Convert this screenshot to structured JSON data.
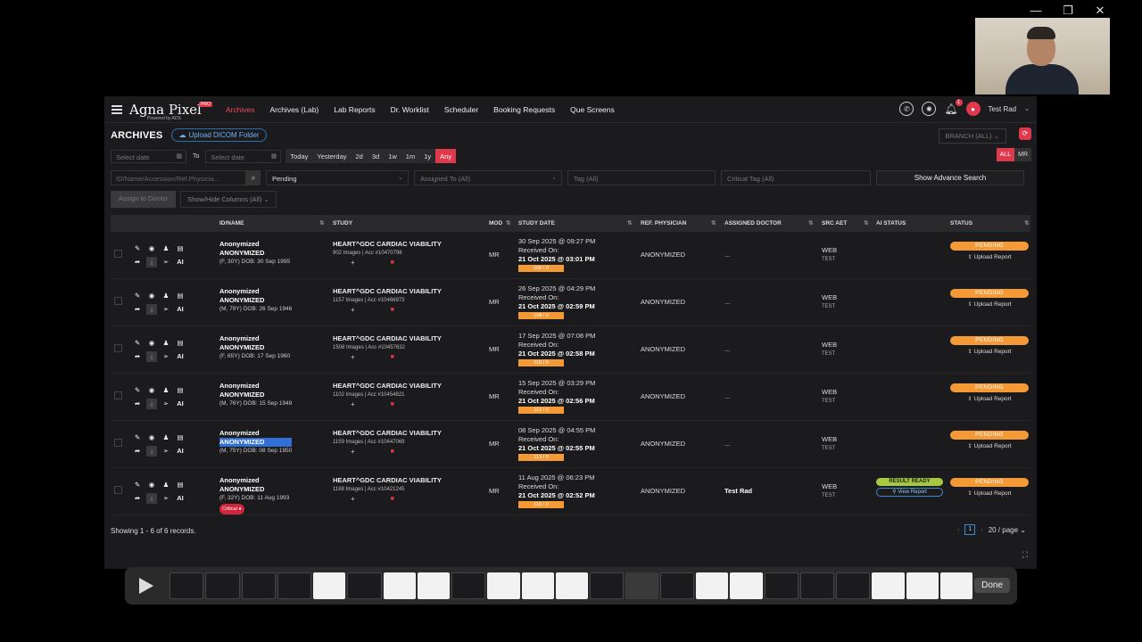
{
  "window": {
    "minimize": "—",
    "maximize": "❐",
    "close": "✕"
  },
  "brand": {
    "name_a": "Agna",
    "name_b": "Pixel",
    "badge": "PRO",
    "powered": "Powered by ADS"
  },
  "nav": [
    "Archives",
    "Archives (Lab)",
    "Lab Reports",
    "Dr. Worklist",
    "Scheduler",
    "Booking Requests",
    "Que Screens"
  ],
  "user": {
    "name": "Test Rad",
    "notifications": "1"
  },
  "header": {
    "title": "ARCHIVES",
    "upload": "Upload DICOM Folder",
    "branch": "BRANCH (ALL)"
  },
  "filters": {
    "date_from_ph": "Select date",
    "to_label": "To",
    "date_to_ph": "Select date",
    "quick": [
      "Today",
      "Yesterday",
      "2d",
      "3d",
      "1w",
      "1m",
      "1y",
      "Any"
    ],
    "modality": [
      "ALL",
      "MR"
    ],
    "search_ph": "ID/Name/Accession/Ref.Physicia...",
    "status_value": "Pending",
    "assigned_ph": "Assigned To (All)",
    "tag_ph": "Tag (All)",
    "critical_ph": "Critical Tag (All)",
    "advance": "Show Advance Search",
    "assign_btn": "Assign to Doctor",
    "cols_btn": "Show/Hide Columns (All)"
  },
  "columns": {
    "id": "ID/NAME",
    "study": "STUDY",
    "mod": "MOD",
    "date": "STUDY DATE",
    "ref": "REF. PHYSICIAN",
    "doc": "ASSIGNED DOCTOR",
    "aet": "SRC AET",
    "ai": "AI STATUS",
    "status": "STATUS"
  },
  "rows": [
    {
      "name": "Anonymized",
      "name2": "ANONYMIZED",
      "meta": "(F, 30Y) DOB: 30 Sep 1995",
      "study": "HEART^GDC CARDIAC VIABILITY",
      "images": "902 Images | Acc #10470798",
      "mod": "MR",
      "date": "30 Sep 2025 @ 09:27 PM",
      "recv_label": "Received On:",
      "recv": "21 Oct 2025 @ 03:01 PM",
      "count": "106 / 0",
      "ref": "ANONYMIZED",
      "doctor": "...",
      "aet1": "WEB",
      "aet2": "TEST",
      "status": "PENDING",
      "upload": "Upload Report"
    },
    {
      "name": "Anonymized",
      "name2": "ANONYMIZED",
      "meta": "(M, 79Y) DOB: 26 Sep 1946",
      "study": "HEART^GDC CARDIAC VIABILITY",
      "images": "1157 Images | Acc #10466973",
      "mod": "MR",
      "date": "26 Sep 2025 @ 04:29 PM",
      "recv_label": "Received On:",
      "recv": "21 Oct 2025 @ 02:59 PM",
      "count": "108 / 0",
      "ref": "ANONYMIZED",
      "doctor": "...",
      "aet1": "WEB",
      "aet2": "TEST",
      "status": "PENDING",
      "upload": "Upload Report"
    },
    {
      "name": "Anonymized",
      "name2": "ANONYMIZED",
      "meta": "(F, 65Y) DOB: 17 Sep 1960",
      "study": "HEART^GDC CARDIAC VIABILITY",
      "images": "1508 Images | Acc #10457632",
      "mod": "MR",
      "date": "17 Sep 2025 @ 07:08 PM",
      "recv_label": "Received On:",
      "recv": "21 Oct 2025 @ 02:58 PM",
      "count": "116 / 0",
      "ref": "ANONYMIZED",
      "doctor": "...",
      "aet1": "WEB",
      "aet2": "TEST",
      "status": "PENDING",
      "upload": "Upload Report"
    },
    {
      "name": "Anonymized",
      "name2": "ANONYMIZED",
      "meta": "(M, 76Y) DOB: 15 Sep 1949",
      "study": "HEART^GDC CARDIAC VIABILITY",
      "images": "1102 Images | Acc #10454821",
      "mod": "MR",
      "date": "15 Sep 2025 @ 03:29 PM",
      "recv_label": "Received On:",
      "recv": "21 Oct 2025 @ 02:56 PM",
      "count": "112 / 0",
      "ref": "ANONYMIZED",
      "doctor": "...",
      "aet1": "WEB",
      "aet2": "TEST",
      "status": "PENDING",
      "upload": "Upload Report"
    },
    {
      "name": "Anonymized",
      "name2": "ANONYMIZED",
      "meta": "(M, 75Y) DOB: 08 Sep 1950",
      "study": "HEART^GDC CARDIAC VIABILITY",
      "images": "1159 Images | Acc #10447069",
      "mod": "MR",
      "date": "08 Sep 2025 @ 04:55 PM",
      "recv_label": "Received On:",
      "recv": "21 Oct 2025 @ 02:55 PM",
      "count": "113 / 0",
      "ref": "ANONYMIZED",
      "doctor": "...",
      "aet1": "WEB",
      "aet2": "TEST",
      "status": "PENDING",
      "upload": "Upload Report"
    },
    {
      "name": "Anonymized",
      "name2": "ANONYMIZED",
      "meta": "(F, 32Y) DOB: 11 Aug 1993",
      "critical": "Critical",
      "study": "HEART^GDC CARDIAC VIABILITY",
      "images": "1188 Images | Acc #10421245",
      "mod": "MR",
      "date": "11 Aug 2025 @ 06:23 PM",
      "recv_label": "Received On:",
      "recv": "21 Oct 2025 @ 02:52 PM",
      "count": "116 / 0",
      "ref": "ANONYMIZED",
      "doctor": "Test Rad",
      "aet1": "WEB",
      "aet2": "TEST",
      "ai_status": "RESULT READY",
      "ai_view": "View Report",
      "status": "PENDING",
      "upload": "Upload Report"
    }
  ],
  "footer": {
    "showing": "Showing 1 - 6 of 6 records.",
    "page": "1",
    "per_page": "20 / page"
  },
  "player": {
    "done": "Done"
  }
}
